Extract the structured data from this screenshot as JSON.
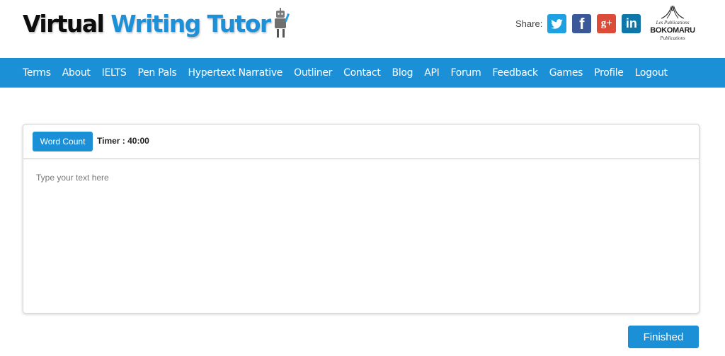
{
  "header": {
    "logo": {
      "part1": "Virtual",
      "part2": "Writing Tutor"
    },
    "share": {
      "label": "Share:",
      "icons": [
        {
          "name": "twitter-icon",
          "glyph": "🐦",
          "color": "#1da1e2"
        },
        {
          "name": "facebook-icon",
          "glyph": "f",
          "color": "#3b5998"
        },
        {
          "name": "google-plus-icon",
          "glyph": "g+",
          "color": "#dc4a38"
        },
        {
          "name": "linkedin-icon",
          "glyph": "in",
          "color": "#0e76a8"
        }
      ]
    },
    "publisher": {
      "top": "Les Publications",
      "name": "BOKOMARU",
      "bottom": "Publications"
    }
  },
  "nav": {
    "items": [
      "Terms",
      "About",
      "IELTS",
      "Pen Pals",
      "Hypertext Narrative",
      "Outliner",
      "Contact",
      "Blog",
      "API",
      "Forum",
      "Feedback",
      "Games",
      "Profile",
      "Logout"
    ]
  },
  "editor": {
    "word_count_label": "Word Count",
    "timer": "Timer : 40:00",
    "placeholder": "Type your text here",
    "value": ""
  },
  "footer": {
    "finished_label": "Finished"
  },
  "colors": {
    "brand_blue": "#1c90d6"
  }
}
